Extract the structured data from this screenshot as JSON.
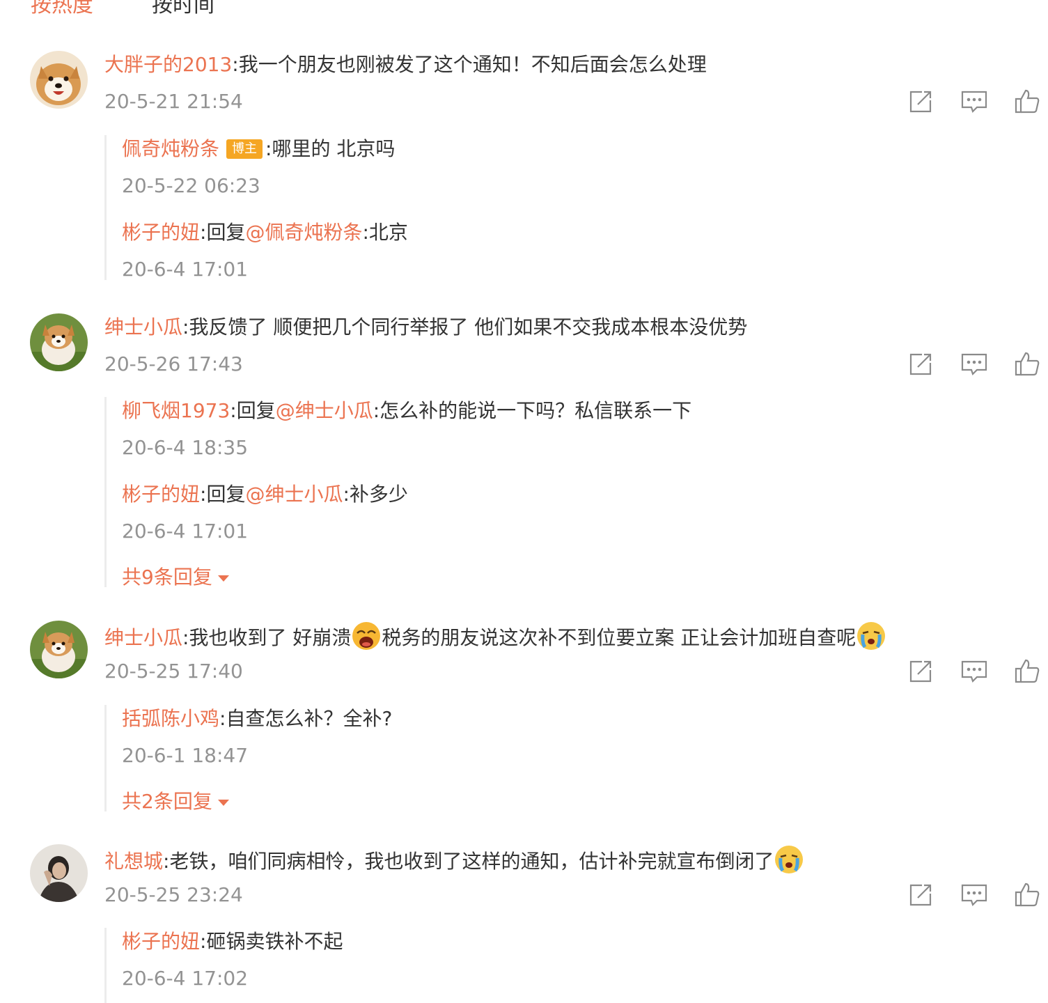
{
  "sort_tabs": {
    "hot": "按热度",
    "time": "按时间"
  },
  "colors": {
    "accent": "#eb7350",
    "text": "#333333",
    "muted": "#939393",
    "badge": "#f5a623"
  },
  "comments": [
    {
      "user": "大胖子的2013",
      "text": ":我一个朋友也刚被发了这个通知！不知后面会怎么处理",
      "time": "20-5-21 21:54",
      "avatar": "shiba-dog-avatar",
      "replies": [
        {
          "user": "佩奇炖粉条",
          "badge": "博主",
          "text": ":哪里的 北京吗",
          "time": "20-5-22 06:23"
        },
        {
          "user": "彬子的妞",
          "reply_prefix": ":回复",
          "mention": "@佩奇炖粉条",
          "text": ":北京",
          "time": "20-6-4 17:01"
        }
      ]
    },
    {
      "user": "绅士小瓜",
      "text": ":我反馈了 顺便把几个同行举报了 他们如果不交我成本根本没优势",
      "time": "20-5-26 17:43",
      "avatar": "corgi-puppy-avatar",
      "replies": [
        {
          "user": "柳飞烟1973",
          "reply_prefix": ":回复",
          "mention": "@绅士小瓜",
          "text": ":怎么补的能说一下吗？私信联系一下",
          "time": "20-6-4 18:35"
        },
        {
          "user": "彬子的妞",
          "reply_prefix": ":回复",
          "mention": "@绅士小瓜",
          "text": ":补多少",
          "time": "20-6-4 17:01"
        }
      ],
      "more": "共9条回复"
    },
    {
      "user": "绅士小瓜",
      "text_a": ":我也收到了 好崩溃",
      "text_b": "税务的朋友说这次补不到位要立案 正让会计加班自查呢",
      "time": "20-5-25 17:40",
      "avatar": "corgi-puppy-avatar",
      "replies": [
        {
          "user": "括弧陈小鸡",
          "text": ":自查怎么补？全补?",
          "time": "20-6-1 18:47"
        }
      ],
      "more": "共2条回复"
    },
    {
      "user": "礼想城",
      "text": ":老铁，咱们同病相怜，我也收到了这样的通知，估计补完就宣布倒闭了",
      "time": "20-5-25 23:24",
      "avatar": "person-photo-avatar",
      "replies": [
        {
          "user": "彬子的妞",
          "text": ":砸锅卖铁补不起",
          "time": "20-6-4 17:02"
        }
      ]
    }
  ]
}
